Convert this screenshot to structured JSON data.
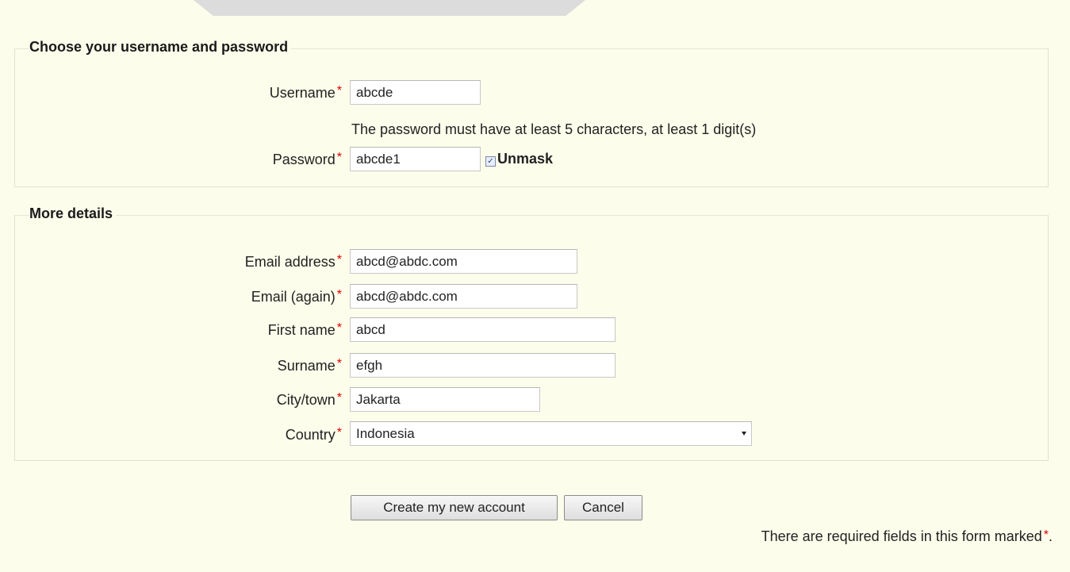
{
  "sections": {
    "account": {
      "title": "Choose your username and password"
    },
    "details": {
      "title": "More details"
    }
  },
  "required_marker": "*",
  "fields": {
    "username": {
      "label": "Username",
      "value": "abcde"
    },
    "password_help": "The password must have at least 5 characters, at least 1 digit(s)",
    "password": {
      "label": "Password",
      "value": "abcde1"
    },
    "unmask": {
      "label": "Unmask",
      "checked": true
    },
    "email": {
      "label": "Email address",
      "value": "abcd@abdc.com"
    },
    "email2": {
      "label": "Email (again)",
      "value": "abcd@abdc.com"
    },
    "firstname": {
      "label": "First name",
      "value": "abcd"
    },
    "surname": {
      "label": "Surname",
      "value": "efgh"
    },
    "city": {
      "label": "City/town",
      "value": "Jakarta"
    },
    "country": {
      "label": "Country",
      "value": "Indonesia"
    }
  },
  "buttons": {
    "submit": "Create my new account",
    "cancel": "Cancel"
  },
  "footer": {
    "note": "There are required fields in this form marked",
    "note_end": "."
  },
  "colors": {
    "background": "#fdfdeb",
    "required": "#dd0000"
  }
}
